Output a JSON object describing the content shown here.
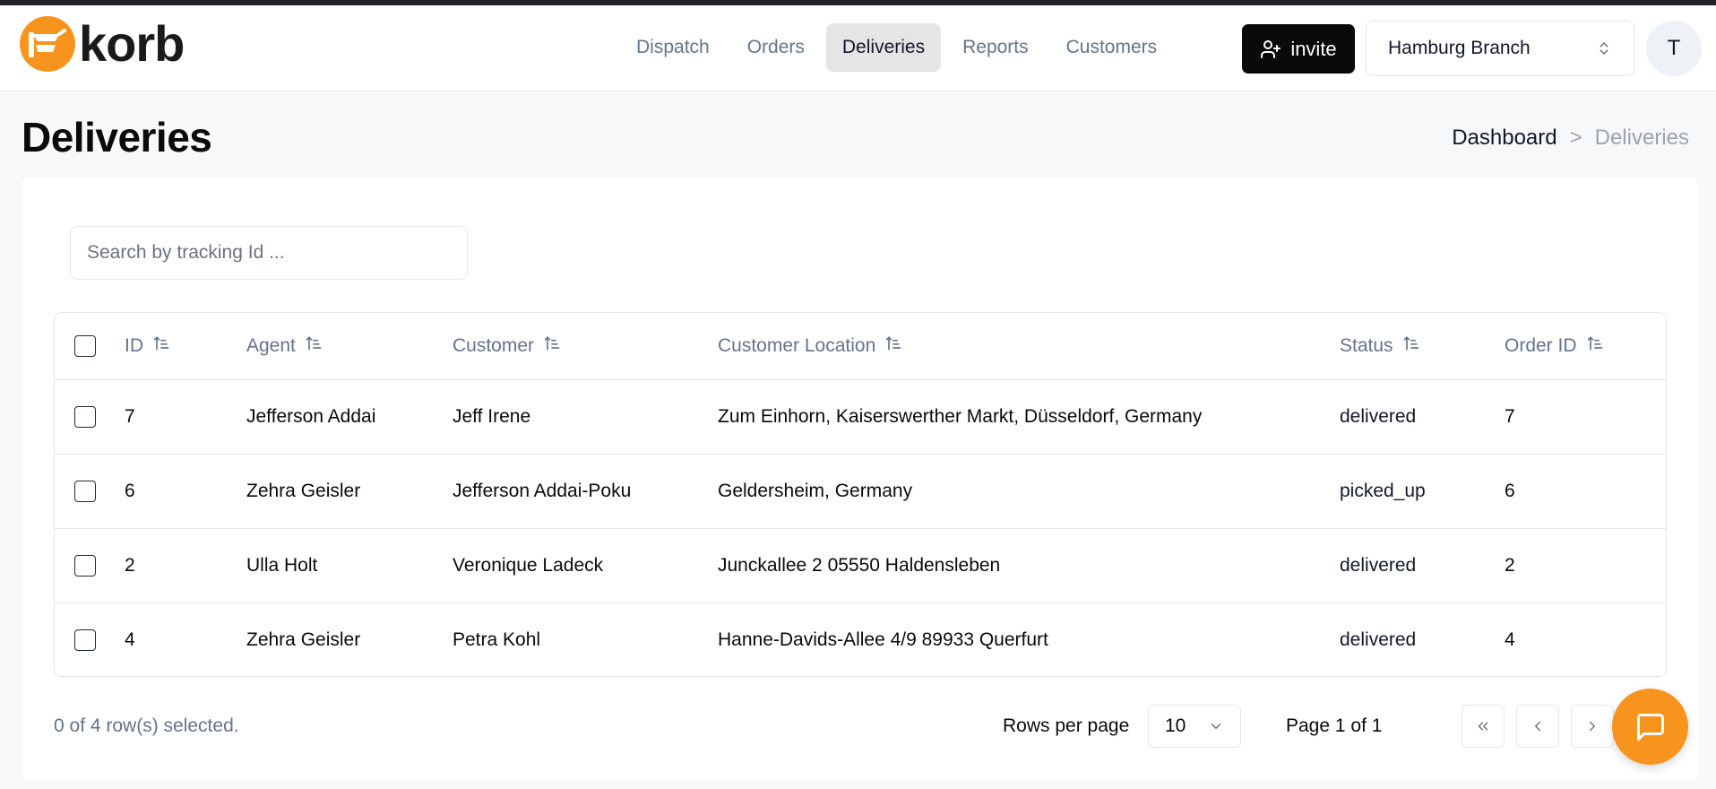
{
  "app": {
    "logo_text": "korb"
  },
  "nav": {
    "items": [
      {
        "label": "Dispatch"
      },
      {
        "label": "Orders"
      },
      {
        "label": "Deliveries",
        "active": true
      },
      {
        "label": "Reports"
      },
      {
        "label": "Customers"
      }
    ]
  },
  "header": {
    "invite_label": "invite",
    "branch_label": "Hamburg Branch",
    "avatar_initial": "T"
  },
  "page": {
    "title": "Deliveries",
    "breadcrumb": {
      "link": "Dashboard",
      "separator": ">",
      "current": "Deliveries"
    }
  },
  "search": {
    "placeholder": "Search by tracking Id ...",
    "value": ""
  },
  "table": {
    "columns": [
      "ID",
      "Agent",
      "Customer",
      "Customer Location",
      "Status",
      "Order ID"
    ],
    "rows": [
      {
        "id": "7",
        "agent": "Jefferson Addai",
        "customer": "Jeff Irene",
        "location": "Zum Einhorn, Kaiserswerther Markt, Düsseldorf, Germany",
        "status": "delivered",
        "order_id": "7"
      },
      {
        "id": "6",
        "agent": "Zehra Geisler",
        "customer": "Jefferson Addai-Poku",
        "location": "Geldersheim, Germany",
        "status": "picked_up",
        "order_id": "6"
      },
      {
        "id": "2",
        "agent": "Ulla Holt",
        "customer": "Veronique Ladeck",
        "location": "Junckallee 2 05550 Haldensleben",
        "status": "delivered",
        "order_id": "2"
      },
      {
        "id": "4",
        "agent": "Zehra Geisler",
        "customer": "Petra Kohl",
        "location": "Hanne-Davids-Allee 4/9 89933 Querfurt",
        "status": "delivered",
        "order_id": "4"
      }
    ]
  },
  "footer": {
    "selected_text": "0 of  4 row(s) selected.",
    "rows_per_page_label": "Rows per page",
    "rows_per_page_value": "10",
    "page_info": "Page 1 of  1"
  },
  "colors": {
    "accent": "#f7941d",
    "dark": "#0a0a0a",
    "muted": "#64748b"
  },
  "icons": {
    "logo": "korb-basket-logo",
    "invite": "user-plus-icon",
    "branch_select": "chevrons-up-down-icon",
    "sort": "sort-ascending-icon",
    "rpp_select": "chevron-down-icon",
    "first_page": "chevrons-left-icon",
    "prev_page": "chevron-left-icon",
    "next_page": "chevron-right-icon",
    "chat": "message-square-icon"
  }
}
